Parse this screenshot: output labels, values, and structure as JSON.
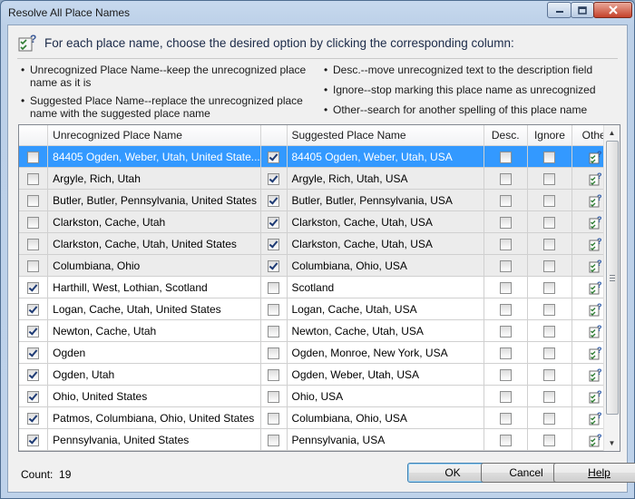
{
  "window": {
    "title": "Resolve All Place Names"
  },
  "header": {
    "instruction": "For each place name, choose the desired option by clicking the corresponding column:"
  },
  "hints": {
    "left": [
      [
        "Unrecognized Place Name--keep the unrecognized place",
        "name as it is"
      ],
      [
        "Suggested Place Name--replace the unrecognized place",
        "name with the suggested place name"
      ]
    ],
    "right": [
      "Desc.--move unrecognized text to the description field",
      "Ignore--stop marking this place name as unrecognized",
      "Other--search for another spelling of this place name"
    ]
  },
  "grid": {
    "columns": [
      "Unrecognized Place Name",
      "Suggested Place Name",
      "Desc.",
      "Ignore",
      "Other"
    ],
    "rows": [
      {
        "keep": false,
        "unrecognized": "84405  Ogden, Weber, Utah, United State...",
        "use_suggested": true,
        "suggested": "84405  Ogden, Weber, Utah, USA",
        "desc": false,
        "ignore": false,
        "state": "selected"
      },
      {
        "keep": false,
        "unrecognized": "Argyle, Rich, Utah",
        "use_suggested": true,
        "suggested": "Argyle, Rich, Utah, USA",
        "desc": false,
        "ignore": false,
        "state": "grey"
      },
      {
        "keep": false,
        "unrecognized": "Butler, Butler, Pennsylvania, United States",
        "use_suggested": true,
        "suggested": "Butler, Butler, Pennsylvania, USA",
        "desc": false,
        "ignore": false,
        "state": "grey"
      },
      {
        "keep": false,
        "unrecognized": "Clarkston, Cache, Utah",
        "use_suggested": true,
        "suggested": "Clarkston, Cache, Utah, USA",
        "desc": false,
        "ignore": false,
        "state": "grey"
      },
      {
        "keep": false,
        "unrecognized": "Clarkston, Cache, Utah, United States",
        "use_suggested": true,
        "suggested": "Clarkston, Cache, Utah, USA",
        "desc": false,
        "ignore": false,
        "state": "grey"
      },
      {
        "keep": false,
        "unrecognized": "Columbiana, Ohio",
        "use_suggested": true,
        "suggested": "Columbiana, Ohio, USA",
        "desc": false,
        "ignore": false,
        "state": "grey"
      },
      {
        "keep": true,
        "unrecognized": "Harthill, West, Lothian, Scotland",
        "use_suggested": false,
        "suggested": "Scotland",
        "desc": false,
        "ignore": false,
        "state": "normal"
      },
      {
        "keep": true,
        "unrecognized": "Logan, Cache, Utah, United States",
        "use_suggested": false,
        "suggested": "Logan, Cache, Utah, USA",
        "desc": false,
        "ignore": false,
        "state": "normal"
      },
      {
        "keep": true,
        "unrecognized": "Newton, Cache, Utah",
        "use_suggested": false,
        "suggested": "Newton, Cache, Utah, USA",
        "desc": false,
        "ignore": false,
        "state": "normal"
      },
      {
        "keep": true,
        "unrecognized": "Ogden",
        "use_suggested": false,
        "suggested": "Ogden, Monroe, New York, USA",
        "desc": false,
        "ignore": false,
        "state": "normal"
      },
      {
        "keep": true,
        "unrecognized": "Ogden, Utah",
        "use_suggested": false,
        "suggested": "Ogden, Weber, Utah, USA",
        "desc": false,
        "ignore": false,
        "state": "normal"
      },
      {
        "keep": true,
        "unrecognized": "Ohio, United States",
        "use_suggested": false,
        "suggested": "Ohio, USA",
        "desc": false,
        "ignore": false,
        "state": "normal"
      },
      {
        "keep": true,
        "unrecognized": "Patmos, Columbiana, Ohio, United States",
        "use_suggested": false,
        "suggested": "Columbiana, Ohio, USA",
        "desc": false,
        "ignore": false,
        "state": "normal"
      },
      {
        "keep": true,
        "unrecognized": "Pennsylvania, United States",
        "use_suggested": false,
        "suggested": "Pennsylvania, USA",
        "desc": false,
        "ignore": false,
        "state": "normal"
      }
    ]
  },
  "footer": {
    "count_label": "Count:",
    "count_value": "19",
    "ok": "OK",
    "cancel": "Cancel",
    "help": "Help"
  },
  "icons": {
    "header": "question-checklist-icon",
    "other": "search-place-icon"
  }
}
